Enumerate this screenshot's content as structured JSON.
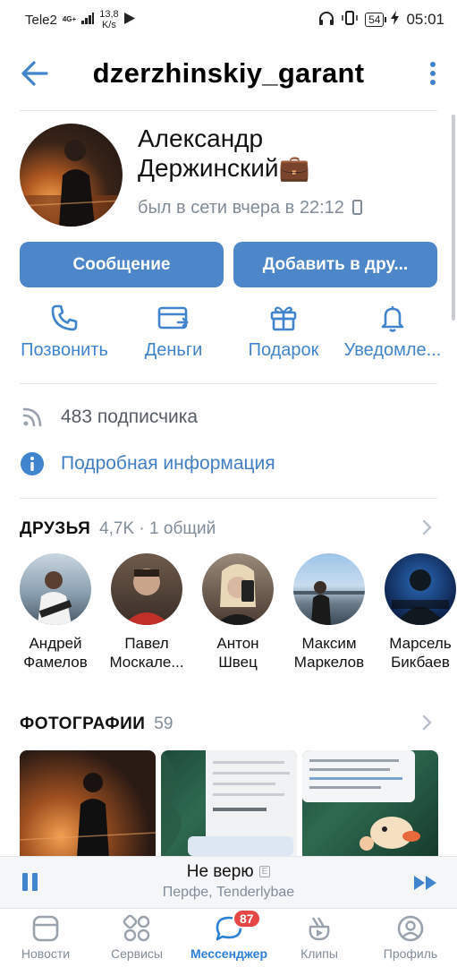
{
  "status_bar": {
    "carrier": "Tele2",
    "network": "4G+",
    "speed_value": "13,8",
    "speed_unit": "K/s",
    "battery": "54",
    "time": "05:01"
  },
  "header": {
    "title": "dzerzhinskiy_garant"
  },
  "profile": {
    "name_line1": "Александр",
    "name_line2": "Держинский💼",
    "last_seen": "был в сети вчера в 22:12",
    "message_button": "Сообщение",
    "add_button": "Добавить в дру..."
  },
  "actions": [
    {
      "label": "Позвонить",
      "icon": "phone-icon"
    },
    {
      "label": "Деньги",
      "icon": "money-card-icon"
    },
    {
      "label": "Подарок",
      "icon": "gift-icon"
    },
    {
      "label": "Уведомле...",
      "icon": "bell-icon"
    }
  ],
  "info": {
    "followers": "483 подписчика",
    "details": "Подробная информация"
  },
  "friends": {
    "title": "ДРУЗЬЯ",
    "count": "4,7K · 1 общий",
    "items": [
      {
        "first": "Андрей",
        "last": "Фамелов"
      },
      {
        "first": "Павел",
        "last": "Москале..."
      },
      {
        "first": "Антон",
        "last": "Швец"
      },
      {
        "first": "Максим",
        "last": "Маркелов"
      },
      {
        "first": "Марсель",
        "last": "Бикбаев"
      }
    ]
  },
  "photos": {
    "title": "ФОТОГРАФИИ",
    "count": "59"
  },
  "player": {
    "track": "Не верю",
    "explicit": "E",
    "artist": "Перфе, Tenderlybae"
  },
  "tabbar": {
    "items": [
      {
        "label": "Новости",
        "icon": "news-icon"
      },
      {
        "label": "Сервисы",
        "icon": "services-icon"
      },
      {
        "label": "Мессенджер",
        "icon": "messenger-icon",
        "badge": "87"
      },
      {
        "label": "Клипы",
        "icon": "clips-icon"
      },
      {
        "label": "Профиль",
        "icon": "profile-icon"
      }
    ]
  },
  "colors": {
    "accent": "#4d87c9",
    "link": "#3f84cc",
    "badge": "#e64646"
  }
}
